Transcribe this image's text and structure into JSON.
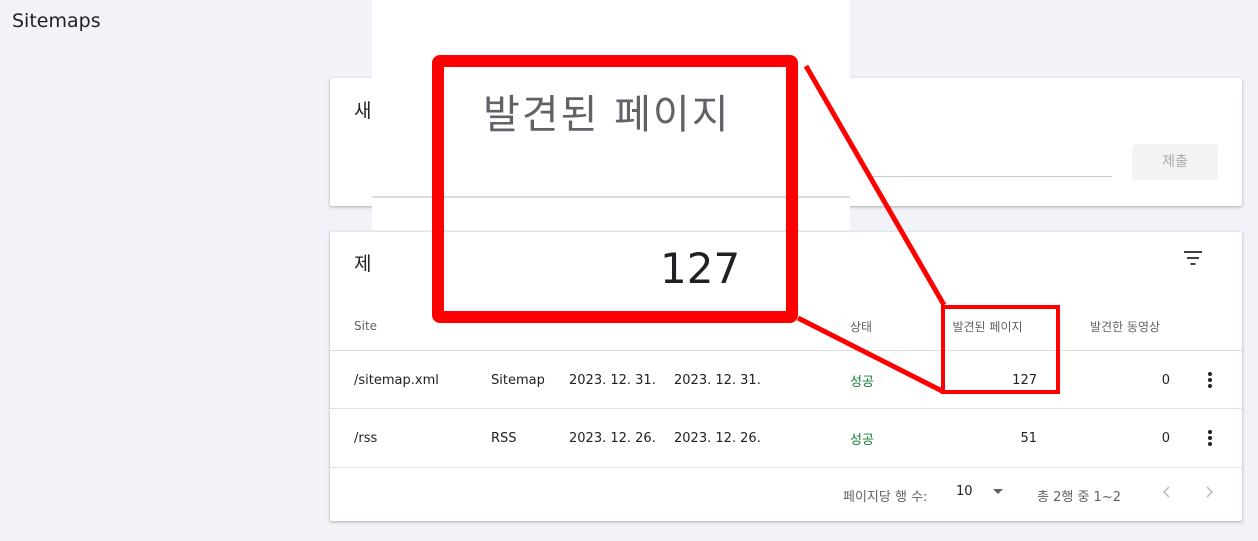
{
  "page": {
    "title": "Sitemaps"
  },
  "add_card": {
    "heading_partial": "새",
    "submit_label": "제출"
  },
  "list_card": {
    "heading_partial": "제",
    "filter_icon": "filter-icon",
    "columns": {
      "path": "Site",
      "status": "상태",
      "pages": "발견된 페이지",
      "videos": "발견한 동영상"
    },
    "rows": [
      {
        "path": "/sitemap.xml",
        "type": "Sitemap",
        "submitted": "2023. 12. 31.",
        "last_read": "2023. 12. 31.",
        "status": "성공",
        "pages": "127",
        "videos": "0"
      },
      {
        "path": "/rss",
        "type": "RSS",
        "submitted": "2023. 12. 26.",
        "last_read": "2023. 12. 26.",
        "status": "성공",
        "pages": "51",
        "videos": "0"
      }
    ],
    "pagination": {
      "rows_per_page_label": "페이지당 행 수:",
      "rows_per_page": "10",
      "range": "총 2행 중 1~2"
    }
  },
  "zoom": {
    "header": "발견된 페이지",
    "value": "127"
  },
  "colors": {
    "highlight": "#ff0000",
    "success": "#188038",
    "background": "#f1f3f9"
  }
}
